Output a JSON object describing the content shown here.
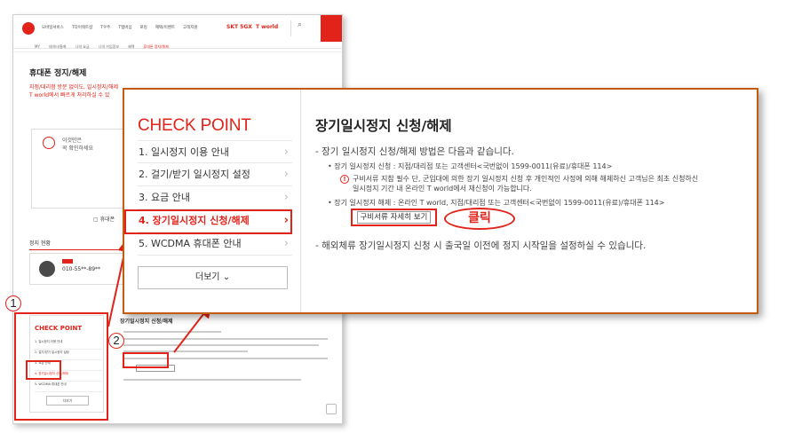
{
  "background_page": {
    "gnb_items": [
      "모바일서비스",
      "T다이렉트샵",
      "T우주",
      "T멤버십",
      "로밍",
      "혜택/이벤트",
      "고객지원"
    ],
    "brands": [
      "SKT 5GX",
      "T world"
    ],
    "subnav_items": [
      "MY",
      "데이터/통화",
      "나의 요금",
      "나의 가입정보",
      "혜택",
      "휴대폰 정지/해제"
    ],
    "title": "휴대폰 정지/해제",
    "desc_line1": "지점/대리점 방문 없이도, 일시정지/해제",
    "desc_line2": "T world에서 빠르게 처리하실 수 있",
    "info_line1": "이것만은",
    "info_line2": "꼭 확인하세요",
    "phone_label": "휴대폰",
    "status_title": "정지 현황",
    "status_tag": "정지",
    "status_number": "010-55**-89**",
    "cp_title": "CHECK POINT",
    "cp_items": [
      "1. 일시정지 이용 안내",
      "2. 걸기/받기 일시정지 설정",
      "3. 요금 안내",
      "4. 장기일시정지 신청/해제",
      "5. WCDMA 휴대폰 안내"
    ],
    "cp_more": "더보기",
    "detail_title": "장기일시정지 신청/해제"
  },
  "steps": [
    "1",
    "2"
  ],
  "overlay": {
    "cp_title": "CHECK POINT",
    "cp_items": [
      {
        "label": "1. 일시정지 이용 안내"
      },
      {
        "label": "2. 걸기/받기 일시정지 설정"
      },
      {
        "label": "3. 요금 안내"
      },
      {
        "label": "4. 장기일시정지 신청/해제",
        "active": true
      },
      {
        "label": "5. WCDMA 휴대폰 안내"
      }
    ],
    "more_label": "더보기",
    "chevron": "›",
    "title": "장기일시정지 신청/해제",
    "para1": "- 장기 일시정지 신청/해제 방법은 다음과 같습니다.",
    "bullet1": "• 장기 일시정지 신청 : 지점/대리점 또는 고객센터<국번없이 1599-0011(유료)/휴대폰 114>",
    "notice_line1": "구비서류 지참 필수 단, 군입대에 의한 장기 일시정지 신청 후 개인적인 사정에 의해 해제하신 고객님은 최초 신청하신",
    "notice_line2": "일시정지 기간 내 온라인 T world에서 재신청이 가능합니다.",
    "notice_icon": "!",
    "bullet2": "• 장기 일시정지 해제 : 온라인 T world, 지점/대리점 또는 고객센터<국번없이 1599-0011(유료)/휴대폰 114>",
    "docs_button": "구비서류 자세히 보기",
    "click_label": "클릭",
    "para2": "- 해외체류 장기일시정지 신청 시 출국일 이전에 정지 시작일을 설정하실 수 있습니다."
  },
  "colors": {
    "accent": "#e2231a",
    "overlay_border": "#c55a11"
  }
}
